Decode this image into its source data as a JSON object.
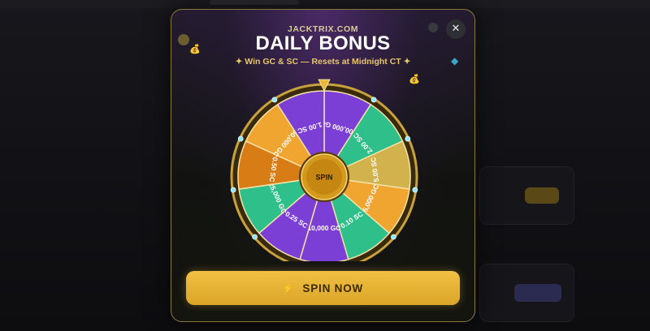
{
  "modal": {
    "brand": "JACKTRIX.COM",
    "title": "DAILY BONUS",
    "subtitle": "✦ Win GC & SC — Resets at Midnight CT ✦",
    "close_label": "✕"
  },
  "wheel": {
    "center_label": "SPIN",
    "segments": [
      {
        "label": "100,000 GC",
        "color": "#7b3fd6"
      },
      {
        "label": "2.00 SC",
        "color": "#2fbf8b"
      },
      {
        "label": "5.00 SC",
        "color": "#d2b24c"
      },
      {
        "label": "5,000 GC",
        "color": "#f0a531"
      },
      {
        "label": "0.10 SC",
        "color": "#2fbf8b"
      },
      {
        "label": "10,000 GC",
        "color": "#7b3fd6"
      },
      {
        "label": "0.25 SC",
        "color": "#7b3fd6"
      },
      {
        "label": "25,000 GC",
        "color": "#2fbf8b"
      },
      {
        "label": "0.50 SC",
        "color": "#d87c15"
      },
      {
        "label": "50,000 GC",
        "color": "#f0a531"
      },
      {
        "label": "1.00 SC",
        "color": "#7b3fd6"
      }
    ]
  },
  "cta": {
    "icon": "lightning-icon",
    "label": "SPIN NOW"
  },
  "colors": {
    "accent_gold": "#e9b73a",
    "frame_gold": "#c8a23c",
    "purple": "#7b3fd6",
    "green": "#2fbf8b",
    "orange": "#f0a531"
  }
}
